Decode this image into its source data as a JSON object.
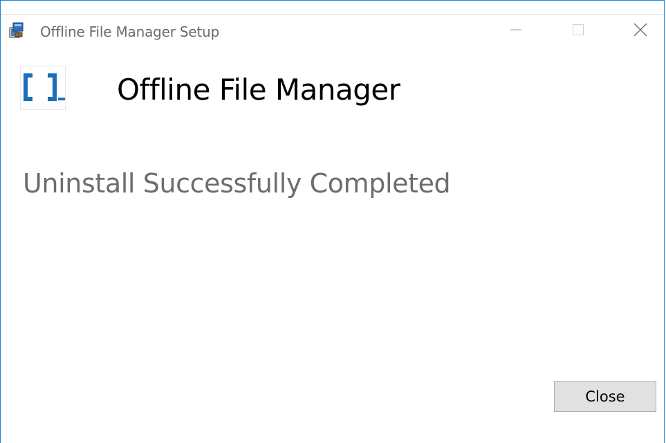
{
  "window": {
    "title": "Offline File Manager Setup",
    "icons": {
      "app": "installer-icon",
      "minimize": "minimize-icon",
      "maximize": "maximize-icon",
      "close": "close-icon"
    }
  },
  "header": {
    "logo": "offline-file-manager-logo",
    "product_name": "Offline File Manager"
  },
  "main": {
    "status": "Uninstall Successfully Completed"
  },
  "footer": {
    "close_label": "Close"
  },
  "colors": {
    "window_border": "#1883d7",
    "logo_blue": "#1a6fb8",
    "status_text": "#6d6d6d",
    "button_bg": "#e1e1e1",
    "button_border": "#adadad"
  }
}
